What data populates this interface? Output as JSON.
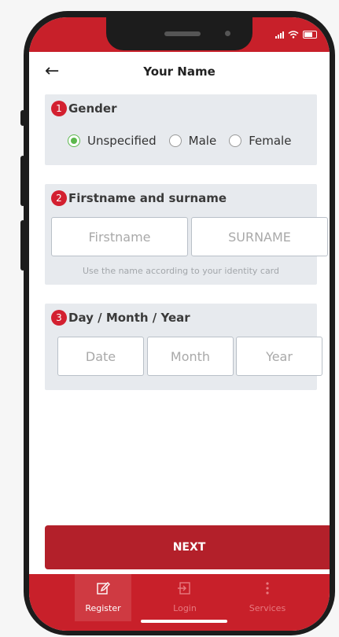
{
  "app": {
    "title": "Your Name",
    "accent": "#c8202a",
    "radio_selected_color": "#5cb84d"
  },
  "sections": {
    "gender": {
      "number": "1",
      "title": "Gender",
      "options": [
        {
          "label": "Unspecified",
          "selected": true
        },
        {
          "label": "Male",
          "selected": false
        },
        {
          "label": "Female",
          "selected": false
        }
      ]
    },
    "name": {
      "number": "2",
      "title": "Firstname and surname",
      "firstname_placeholder": "Firstname",
      "surname_placeholder": "SURNAME",
      "hint": "Use the name according to your identity card"
    },
    "dob": {
      "number": "3",
      "title": "Day / Month / Year",
      "date_placeholder": "Date",
      "month_placeholder": "Month",
      "year_placeholder": "Year"
    }
  },
  "next_label": "NEXT",
  "tabs": [
    {
      "label": "Register",
      "icon": "edit-icon",
      "active": true
    },
    {
      "label": "Login",
      "icon": "login-icon",
      "active": false
    },
    {
      "label": "Services",
      "icon": "more-vertical-icon",
      "active": false
    }
  ]
}
